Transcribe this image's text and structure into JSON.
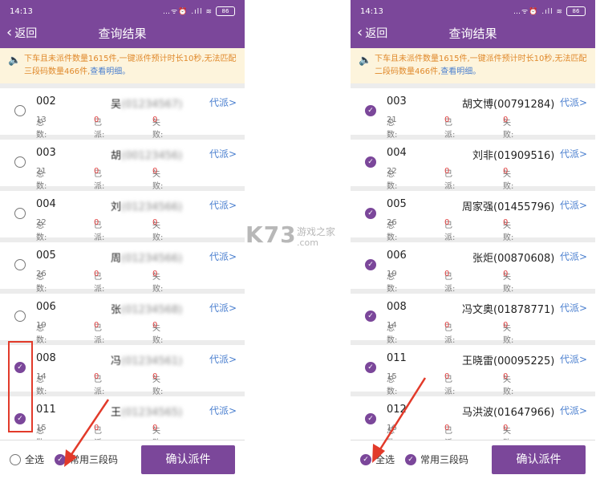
{
  "status": {
    "time": "14:13",
    "icons": "…ᯤ⏰ .ıll ≋",
    "battery": "86"
  },
  "header": {
    "back_label": "返回",
    "title": "查询结果"
  },
  "notice": {
    "left_text": "下车且未派件数量1615件,一键派件预计时长10秒,无法匹配三段码数量466件,",
    "right_text": "下车且未派件数量1615件,一键派件预计时长10秒,无法匹配二段码数量466件,",
    "link": "查看明细。",
    "icon": "speaker-icon",
    "color": "#e0892b"
  },
  "labels": {
    "total": "总数:",
    "sent": "已派:",
    "failed": "失败:",
    "dispatch": "代派>"
  },
  "left_list": [
    {
      "code": "002",
      "name": "吴",
      "phone": "(01234567)",
      "total": "13",
      "sent": "0",
      "failed": "0",
      "checked": false
    },
    {
      "code": "003",
      "name": "胡",
      "phone": "(00123456)",
      "total": "21",
      "sent": "0",
      "failed": "0",
      "checked": false
    },
    {
      "code": "004",
      "name": "刘",
      "phone": "(01234566)",
      "total": "22",
      "sent": "0",
      "failed": "0",
      "checked": false
    },
    {
      "code": "005",
      "name": "周",
      "phone": "(01234566)",
      "total": "26",
      "sent": "0",
      "failed": "0",
      "checked": false
    },
    {
      "code": "006",
      "name": "张",
      "phone": "(01234568)",
      "total": "19",
      "sent": "0",
      "failed": "0",
      "checked": false
    },
    {
      "code": "008",
      "name": "冯",
      "phone": "(01234561)",
      "total": "14",
      "sent": "0",
      "failed": "0",
      "checked": true
    },
    {
      "code": "011",
      "name": "王",
      "phone": "(01234565)",
      "total": "15",
      "sent": "0",
      "failed": "0",
      "checked": true
    }
  ],
  "right_list": [
    {
      "code": "003",
      "name": "胡文博",
      "phone": "(00791284)",
      "total": "21",
      "sent": "0",
      "failed": "0",
      "checked": true
    },
    {
      "code": "004",
      "name": "刘非",
      "phone": "(01909516)",
      "total": "22",
      "sent": "0",
      "failed": "0",
      "checked": true
    },
    {
      "code": "005",
      "name": "周家强",
      "phone": "(01455796)",
      "total": "26",
      "sent": "0",
      "failed": "0",
      "checked": true
    },
    {
      "code": "006",
      "name": "张炬",
      "phone": "(00870608)",
      "total": "19",
      "sent": "0",
      "failed": "0",
      "checked": true
    },
    {
      "code": "008",
      "name": "冯文奥",
      "phone": "(01878771)",
      "total": "14",
      "sent": "0",
      "failed": "0",
      "checked": true
    },
    {
      "code": "011",
      "name": "王晓雷",
      "phone": "(00095225)",
      "total": "15",
      "sent": "0",
      "failed": "0",
      "checked": true
    },
    {
      "code": "012",
      "name": "马洪波",
      "phone": "(01647966)",
      "total": "16",
      "sent": "0",
      "failed": "0",
      "checked": true
    }
  ],
  "bottom": {
    "select_all": "全选",
    "common_code": "常用三段码",
    "confirm": "确认派件",
    "left_select_all_checked": false,
    "left_common_checked": true,
    "right_select_all_checked": true,
    "right_common_checked": true
  },
  "watermark": {
    "logo": "K73",
    "text": "游戏之家",
    "domain": ".com"
  },
  "colors": {
    "brand": "#7b479a",
    "link": "#4a7fcf",
    "failed": "#e04040",
    "annotation": "#e23a2a"
  }
}
